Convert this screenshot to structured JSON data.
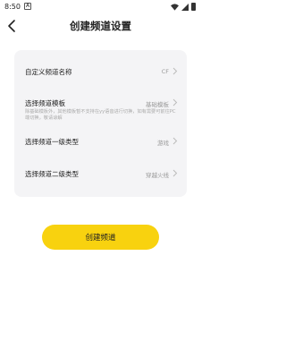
{
  "status_bar": {
    "time": "8:50",
    "notification_badge": "A"
  },
  "header": {
    "title": "创建频道设置"
  },
  "settings": [
    {
      "label": "自定义频道名称",
      "value": "CF"
    },
    {
      "label": "选择频道模板",
      "value": "基础模板",
      "description": "除基础模板外，其他模板暂不支持在yy语音进行切换，如有需要可前往PC端切换，敬请谅解"
    },
    {
      "label": "选择频道一级类型",
      "value": "游戏"
    },
    {
      "label": "选择频道二级类型",
      "value": "穿越火线"
    }
  ],
  "actions": {
    "create_label": "创建频道"
  },
  "colors": {
    "accent": "#f8d20f",
    "card_bg": "#f4f4f6"
  }
}
